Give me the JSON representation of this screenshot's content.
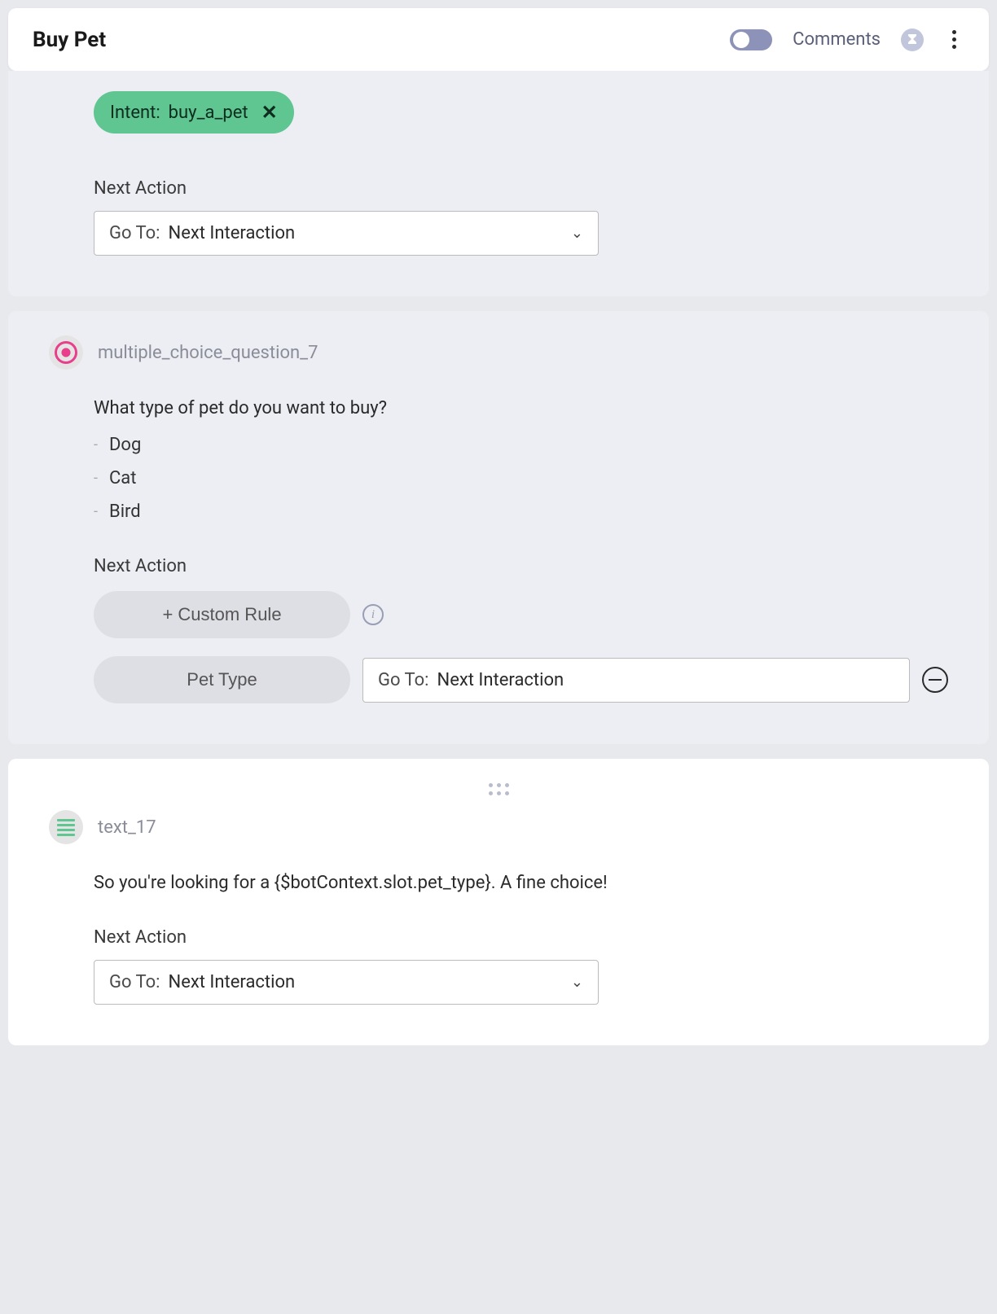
{
  "header": {
    "title": "Buy Pet",
    "comments_label": "Comments"
  },
  "card1": {
    "intent_prefix": "Intent:",
    "intent_value": "buy_a_pet",
    "next_action_label": "Next Action",
    "goto_prefix": "Go To:",
    "goto_value": "Next Interaction"
  },
  "card2": {
    "node_name": "multiple_choice_question_7",
    "question": "What type of pet do you want to buy?",
    "options": [
      "Dog",
      "Cat",
      "Bird"
    ],
    "next_action_label": "Next Action",
    "custom_rule_button": "+ Custom Rule",
    "rule_pill": "Pet Type",
    "goto_prefix": "Go To:",
    "goto_value": "Next Interaction"
  },
  "card3": {
    "node_name": "text_17",
    "body": "So you're looking for a {$botContext.slot.pet_type}. A fine choice!",
    "next_action_label": "Next Action",
    "goto_prefix": "Go To:",
    "goto_value": "Next Interaction"
  }
}
